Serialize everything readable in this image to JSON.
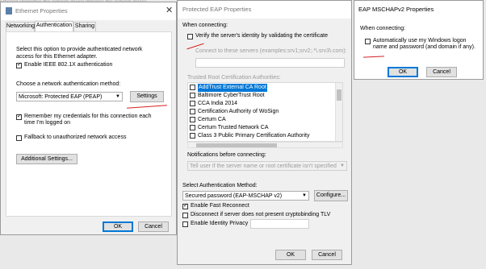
{
  "ethernet": {
    "title": "Ethernet Properties",
    "tabs": [
      "Networking",
      "Authentication",
      "Sharing"
    ],
    "description": "Select this option to provide authenticated network access for this Ethernet adapter.",
    "enable_8021x": "Enable IEEE 802.1X authentication",
    "method_label": "Choose a network authentication method:",
    "method_value": "Microsoft: Protected EAP (PEAP)",
    "settings": "Settings",
    "remember": "Remember my credentials for this connection each time I'm logged on",
    "fallback": "Fallback to unauthorized network access",
    "additional": "Additional Settings...",
    "ok": "OK",
    "cancel": "Cancel",
    "background_text": "Ethernet Properties          this network device           Wireless this network device"
  },
  "peap": {
    "title": "Protected EAP Properties",
    "when_connecting": "When connecting:",
    "verify": "Verify the server's identity by validating the certificate",
    "connect_servers": "Connect to these servers (examples:srv1;srv2;.*\\.srv3\\.com):",
    "trusted_root": "Trusted Root Certification Authorities:",
    "cas": [
      "AddTrust External CA Root",
      "Baltimore CyberTrust Root",
      "CCA India 2014",
      "Certification Authority of WoSign",
      "Certum CA",
      "Certum Trusted Network CA",
      "Class 3 Public Primary Certification Authority"
    ],
    "notifications_label": "Notifications before connecting:",
    "notifications_value": "Tell user if the server name or root certificate isn't specified",
    "auth_method_label": "Select Authentication Method:",
    "auth_method_value": "Secured password (EAP-MSCHAP v2)",
    "configure": "Configure...",
    "fast_reconnect": "Enable Fast Reconnect",
    "disconnect_tlv": "Disconnect if server does not present cryptobinding TLV",
    "identity_privacy": "Enable Identity Privacy",
    "ok": "OK",
    "cancel": "Cancel"
  },
  "mschap": {
    "title": "EAP MSCHAPv2 Properties",
    "when_connecting": "When connecting:",
    "auto_logon": "Automatically use my Windows logon name and password (and domain if any).",
    "ok": "OK",
    "cancel": "Cancel"
  },
  "colors": {
    "accent": "#0078d7",
    "annotation": "#d62020",
    "selection": "#0078d7"
  }
}
